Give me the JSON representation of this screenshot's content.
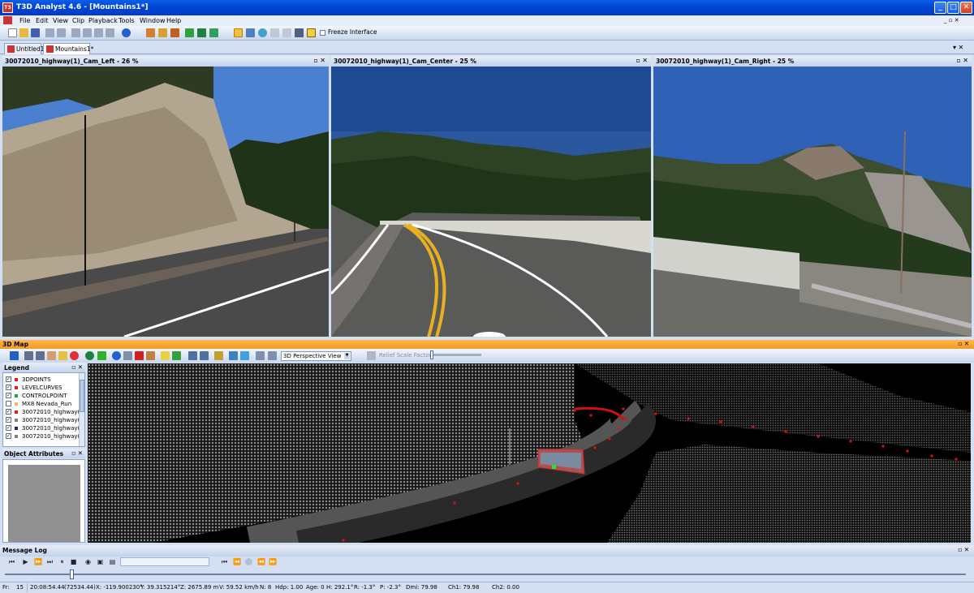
{
  "window": {
    "title": "T3D Analyst 4.6 - [Mountains1*]",
    "minimize": "_",
    "maximize": "□",
    "close": "✕"
  },
  "menu": {
    "items": [
      "File",
      "Edit",
      "View",
      "Clip",
      "Playback",
      "Tools",
      "Window",
      "Help"
    ],
    "mdi_controls": "_ ▫ ✕"
  },
  "toolbar": {
    "freeze_interface": "Freeze Interface"
  },
  "tabs": [
    "Untitled1",
    "Mountains1*"
  ],
  "tabs_controls": "▾ ✕",
  "cameras": [
    {
      "title": "30072010_highway(1)_Cam_Left - 26 %"
    },
    {
      "title": "30072010_highway(1)_Cam_Center - 25 %"
    },
    {
      "title": "30072010_highway(1)_Cam_Right - 25 %"
    }
  ],
  "pane_controls": "▫ ✕",
  "map": {
    "title": "3D Map",
    "view_mode": "3D Perspective View",
    "relief_label": "Relief Scale Factor:"
  },
  "legend": {
    "title": "Legend",
    "items": [
      {
        "label": "3DPOINTS",
        "checked": true,
        "color": "#e02020"
      },
      {
        "label": "LEVELCURVES",
        "checked": true,
        "color": "#e02020"
      },
      {
        "label": "CONTROLPOINT",
        "checked": true,
        "color": "#22aa22"
      },
      {
        "label": "MX8 Nevada_Run",
        "checked": false,
        "color": "#e8c060"
      },
      {
        "label": "30072010_highway(1",
        "checked": true,
        "color": "#e02020"
      },
      {
        "label": "30072010_highway(1",
        "checked": true,
        "color": "#808080"
      },
      {
        "label": "30072010_highway(1",
        "checked": true,
        "color": "#1a1aa8"
      },
      {
        "label": "30072010_highway(1",
        "checked": true,
        "color": "#808080"
      }
    ]
  },
  "object_attributes": {
    "title": "Object Attributes"
  },
  "message_log": {
    "title": "Message Log"
  },
  "status": {
    "fr_label": "Fr:",
    "fr": "15",
    "time": "20:08:54.44",
    "secs": "(72534.44)",
    "x": "X: -119.900230°",
    "y": "Y: 39.315214°",
    "z": "Z: 2675.89 m",
    "v": "V: 59.52 km/h",
    "n": "N: 8",
    "hdp": "Hdp: 1.00",
    "age": "Age: 0",
    "h": "H: 292.1°",
    "r": "R: -1.3°",
    "p": "P: -2.3°",
    "dmi": "Dmi: 79.98",
    "ch1": "Ch1: 79.98",
    "ch2": "Ch2: 0.00"
  },
  "colors": {
    "title_bar": "#0146d6",
    "map_header": "#f59a20",
    "chrome": "#d4e0f2"
  }
}
